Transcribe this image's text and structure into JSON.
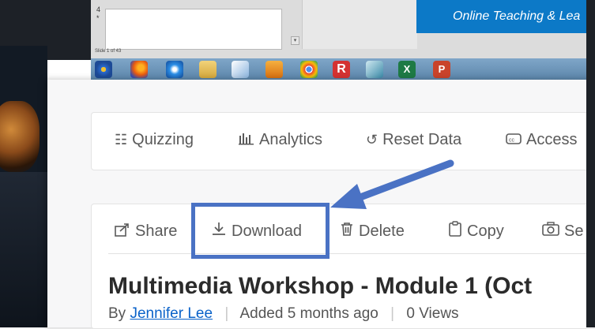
{
  "ppt": {
    "slide_number": "4",
    "slide_star": "*",
    "scroll_arrow": "▾",
    "slide_counter": "Slide 1 of 43",
    "banner_text": "Online Teaching & Lea"
  },
  "taskbar": {
    "icons": [
      "windows-start-icon",
      "firefox-icon",
      "internet-explorer-icon",
      "file-explorer-icon",
      "paint-icon",
      "media-player-icon",
      "chrome-icon",
      "r-app-icon",
      "app-icon",
      "excel-icon",
      "powerpoint-icon"
    ]
  },
  "toolbar": {
    "quizzing": "Quizzing",
    "analytics": "Analytics",
    "reset_data": "Reset Data",
    "accessibility": "Access"
  },
  "actions": {
    "share": "Share",
    "download": "Download",
    "delete": "Delete",
    "copy": "Copy",
    "settings": "Se"
  },
  "media": {
    "title": "Multimedia Workshop - Module 1 (Oct",
    "by_prefix": "By",
    "author": "Jennifer Lee",
    "added": "Added 5 months ago",
    "views": "0 Views"
  },
  "colors": {
    "highlight": "#4a72c4",
    "banner": "#0c79c7",
    "link": "#0a62c9"
  }
}
